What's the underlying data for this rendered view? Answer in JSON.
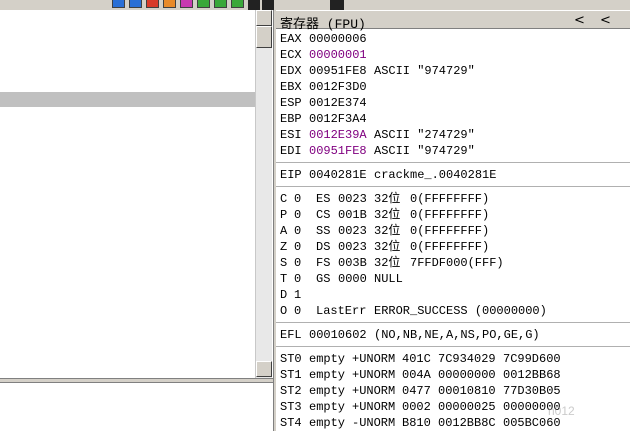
{
  "colors": {
    "modified": "#800080",
    "normal": "#000000",
    "highlight": "#c0c0c0",
    "panel": "#d4d0c8"
  },
  "toolbar": {
    "icons": [
      "blue-icon",
      "blue-icon",
      "red-icon",
      "orange-icon",
      "magenta-icon",
      "green-icon",
      "green-icon",
      "green-icon"
    ]
  },
  "registers": {
    "title": "寄存器 (FPU)",
    "nav_left": "<",
    "nav_right": "<",
    "general": [
      {
        "name": "EAX",
        "value": "00000006",
        "comment": "",
        "modified": false
      },
      {
        "name": "ECX",
        "value": "00000001",
        "comment": "",
        "modified": true
      },
      {
        "name": "EDX",
        "value": "00951FE8",
        "comment": "ASCII \"974729\"",
        "modified": false
      },
      {
        "name": "EBX",
        "value": "0012F3D0",
        "comment": "",
        "modified": false
      },
      {
        "name": "ESP",
        "value": "0012E374",
        "comment": "",
        "modified": false
      },
      {
        "name": "EBP",
        "value": "0012F3A4",
        "comment": "",
        "modified": false
      },
      {
        "name": "ESI",
        "value": "0012E39A",
        "comment": "ASCII \"274729\"",
        "modified": true
      },
      {
        "name": "EDI",
        "value": "00951FE8",
        "comment": "ASCII \"974729\"",
        "modified": true
      }
    ],
    "eip": {
      "name": "EIP",
      "value": "0040281E",
      "comment": "crackme_.0040281E"
    },
    "flags": [
      {
        "flag": "C",
        "bit": "0",
        "seg": "ES",
        "sel": "0023",
        "bits": "32位",
        "info": "0(FFFFFFFF)"
      },
      {
        "flag": "P",
        "bit": "0",
        "seg": "CS",
        "sel": "001B",
        "bits": "32位",
        "info": "0(FFFFFFFF)"
      },
      {
        "flag": "A",
        "bit": "0",
        "seg": "SS",
        "sel": "0023",
        "bits": "32位",
        "info": "0(FFFFFFFF)"
      },
      {
        "flag": "Z",
        "bit": "0",
        "seg": "DS",
        "sel": "0023",
        "bits": "32位",
        "info": "0(FFFFFFFF)"
      },
      {
        "flag": "S",
        "bit": "0",
        "seg": "FS",
        "sel": "003B",
        "bits": "32位",
        "info": "7FFDF000(FFF)"
      },
      {
        "flag": "T",
        "bit": "0",
        "seg": "GS",
        "sel": "0000",
        "bits": "NULL",
        "info": ""
      },
      {
        "flag": "D",
        "bit": "1",
        "seg": "",
        "sel": "",
        "bits": "",
        "info": ""
      },
      {
        "flag": "O",
        "bit": "0",
        "seg": "LastErr",
        "sel": "",
        "bits": "ERROR_SUCCESS (00000000)",
        "info": ""
      }
    ],
    "efl": {
      "name": "EFL",
      "value": "00010602",
      "comment": "(NO,NB,NE,A,NS,PO,GE,G)"
    },
    "fpu": [
      {
        "name": "ST0",
        "state": "empty",
        "sign": "+UNORM",
        "exp": "401C",
        "hi": "7C934029",
        "lo": "7C99D600"
      },
      {
        "name": "ST1",
        "state": "empty",
        "sign": "+UNORM",
        "exp": "004A",
        "hi": "00000000",
        "lo": "0012BB68"
      },
      {
        "name": "ST2",
        "state": "empty",
        "sign": "+UNORM",
        "exp": "0477",
        "hi": "00010810",
        "lo": "77D30B05"
      },
      {
        "name": "ST3",
        "state": "empty",
        "sign": "+UNORM",
        "exp": "0002",
        "hi": "00000025",
        "lo": "00000000"
      },
      {
        "name": "ST4",
        "state": "empty",
        "sign": "-UNORM",
        "exp": "B810",
        "hi": "0012BB8C",
        "lo": "005BC060"
      }
    ]
  },
  "watermark": "n012"
}
